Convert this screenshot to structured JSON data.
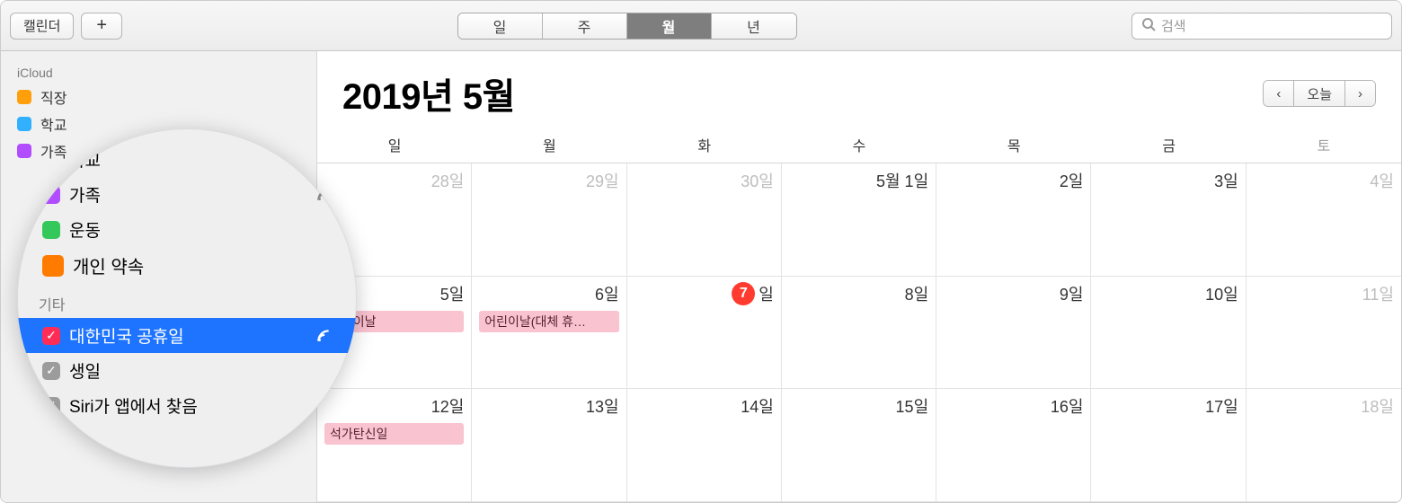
{
  "toolbar": {
    "calendars_button": "캘린더",
    "add_button_symbol": "+",
    "views": {
      "day": "일",
      "week": "주",
      "month": "월",
      "year": "년",
      "active": "month"
    },
    "search_placeholder": "검색"
  },
  "sidebar": {
    "section_icloud": "iCloud",
    "section_other": "기타",
    "icloud_items": [
      {
        "label": "직장",
        "color": "#ff9f0a"
      },
      {
        "label": "학교",
        "color": "#30b0ff"
      },
      {
        "label": "가족",
        "color": "#b14cff"
      },
      {
        "label": "운동",
        "color": "#34c759"
      },
      {
        "label": "개인 약속",
        "color": "#ff7b00"
      }
    ],
    "other_items": [
      {
        "label": "대한민국 공휴일",
        "selected": true,
        "subscribed": true
      },
      {
        "label": "생일"
      },
      {
        "label": "Siri가 앱에서 찾음"
      }
    ]
  },
  "calendar": {
    "title": "2019년 5월",
    "nav": {
      "prev": "‹",
      "today": "오늘",
      "next": "›"
    },
    "dow": [
      "일",
      "월",
      "화",
      "수",
      "목",
      "금",
      "토"
    ],
    "weeks": [
      {
        "days": [
          {
            "label": "28일",
            "other": true
          },
          {
            "label": "29일",
            "other": true
          },
          {
            "label": "30일",
            "other": true
          },
          {
            "label": "5월 1일"
          },
          {
            "label": "2일"
          },
          {
            "label": "3일"
          },
          {
            "label": "4일",
            "weekend": true
          }
        ]
      },
      {
        "days": [
          {
            "label": "5일",
            "events": [
              "어린이날"
            ]
          },
          {
            "label": "6일",
            "events": [
              "어린이날(대체 휴…"
            ]
          },
          {
            "label": "7일",
            "today": true,
            "today_num": "7",
            "today_suffix": "일"
          },
          {
            "label": "8일"
          },
          {
            "label": "9일"
          },
          {
            "label": "10일"
          },
          {
            "label": "11일",
            "weekend": true
          }
        ]
      },
      {
        "days": [
          {
            "label": "12일",
            "events": [
              "석가탄신일"
            ]
          },
          {
            "label": "13일"
          },
          {
            "label": "14일"
          },
          {
            "label": "15일"
          },
          {
            "label": "16일"
          },
          {
            "label": "17일"
          },
          {
            "label": "18일",
            "weekend": true
          }
        ]
      }
    ]
  }
}
